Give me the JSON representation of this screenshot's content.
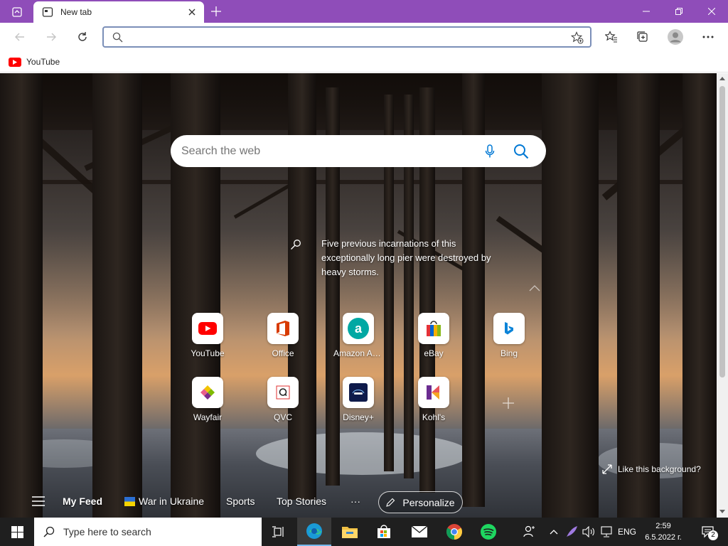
{
  "browser": {
    "tab": {
      "title": "New tab"
    },
    "address": {
      "value": "",
      "placeholder": ""
    },
    "favorites": [
      {
        "label": "YouTube"
      }
    ]
  },
  "newtab": {
    "search": {
      "placeholder": "Search the web"
    },
    "fact": "Five previous incarnations of this exceptionally long pier were destroyed by heavy storms.",
    "quick_links": [
      {
        "label": "YouTube",
        "icon": "youtube-icon"
      },
      {
        "label": "Office",
        "icon": "office-icon"
      },
      {
        "label": "Amazon Assi...",
        "icon": "amazon-assistant-icon"
      },
      {
        "label": "eBay",
        "icon": "ebay-icon"
      },
      {
        "label": "Bing",
        "icon": "bing-icon"
      },
      {
        "label": "Wayfair",
        "icon": "wayfair-icon"
      },
      {
        "label": "QVC",
        "icon": "qvc-icon"
      },
      {
        "label": "Disney+",
        "icon": "disney-plus-icon"
      },
      {
        "label": "Kohl's",
        "icon": "kohls-icon"
      }
    ],
    "like_background": "Like this background?",
    "feed": {
      "my_feed": "My Feed",
      "war_in_ukraine": "War in Ukraine",
      "sports": "Sports",
      "top_stories": "Top Stories",
      "more": "···",
      "personalize": "Personalize"
    }
  },
  "taskbar": {
    "search_placeholder": "Type here to search",
    "language": "ENG",
    "time": "2:59",
    "date": "6.5.2022 г.",
    "notification_count": "2"
  },
  "colors": {
    "titlebar": "#8f4db9",
    "accent": "#0078d4",
    "taskbar": "#1f1f1f"
  }
}
